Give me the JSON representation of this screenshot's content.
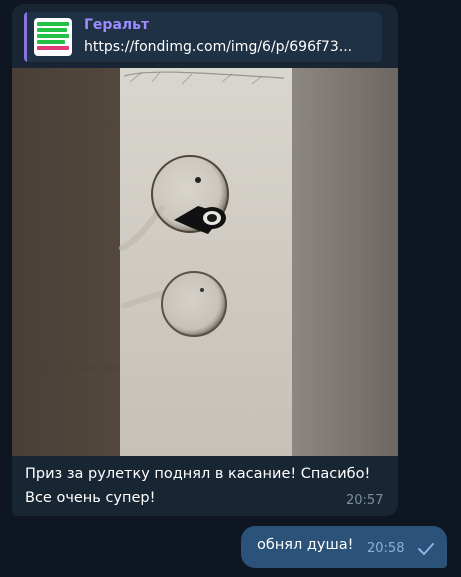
{
  "incoming_message": {
    "reply": {
      "name": "Геральт",
      "url": "https://fondimg.com/img/6/p/696f73..."
    },
    "caption_line1": "Приз за рулетку поднял в касание! Спасибо!",
    "caption_line2": "Все очень супер!",
    "time": "20:57"
  },
  "outgoing_message": {
    "text": "обнял душа!",
    "time": "20:58",
    "status_icon": "single-check-icon"
  },
  "colors": {
    "background": "#0e1621",
    "incoming_bubble": "#182533",
    "outgoing_bubble": "#2b5278",
    "accent": "#9e8cff"
  }
}
